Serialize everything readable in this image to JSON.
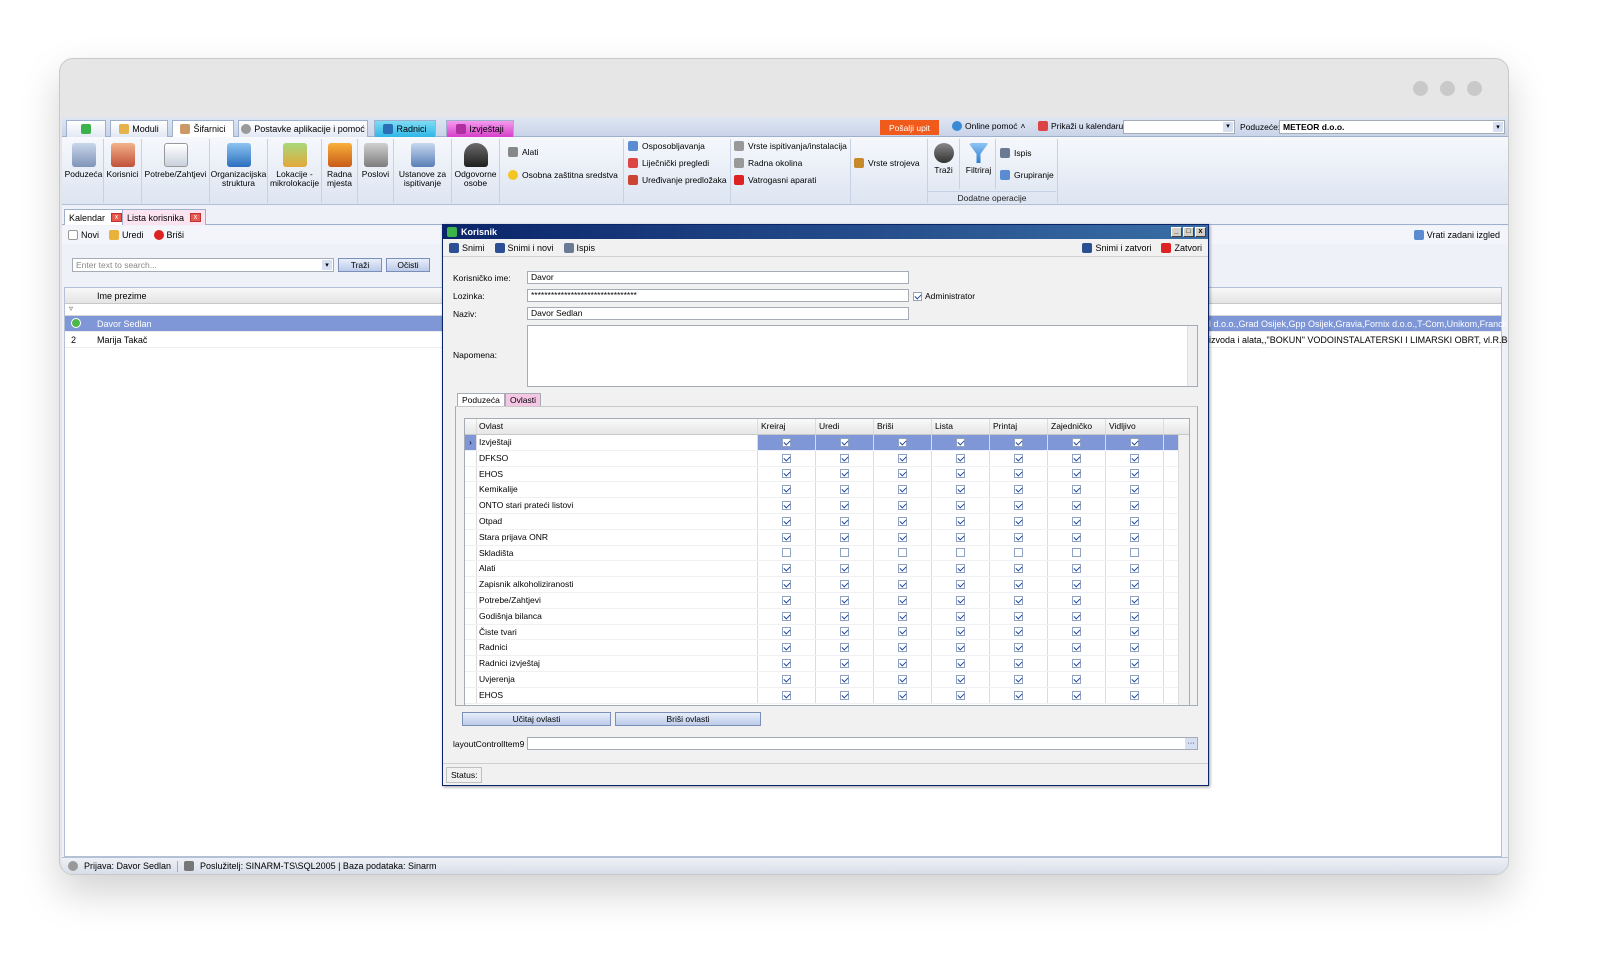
{
  "top_tabs": [
    "Moduli",
    "Šifarnici",
    "Postavke aplikacije i pomoć",
    "Radnici",
    "Izvještaji"
  ],
  "top_right": {
    "send_label": "Pošalji upit",
    "help_label": "Online pomoć",
    "calendar_label": "Prikaži u kalendaru",
    "company_label": "Poduzeće:",
    "company_value": "METEOR d.o.o."
  },
  "ribbon": {
    "buttons": [
      "Poduzeća",
      "Korisnici",
      "Potrebe/Zahtjevi",
      "Organizacijska struktura",
      "Lokacije - mikrolokacije",
      "Radna mjesta",
      "Poslovi",
      "Ustanove za ispitivanje",
      "Odgovorne osobe"
    ],
    "small": [
      "Alati",
      "Osobna zaštitna sredstva",
      "Osposobljavanja",
      "Liječnički pregledi",
      "Uređivanje predložaka",
      "Vrste ispitivanja/instalacija",
      "Radna okolina",
      "Vatrogasni aparati",
      "Vrste strojeva"
    ],
    "ops": {
      "search": "Traži",
      "filter": "Filtriraj",
      "print": "Ispis",
      "group": "Grupiranje",
      "group_title": "Dodatne operacije"
    }
  },
  "doc_tabs": [
    "Kalendar",
    "Lista korisnika"
  ],
  "toolbar": {
    "new": "Novi",
    "edit": "Uredi",
    "delete": "Briši",
    "reset": "Vrati zadani izgled"
  },
  "search": {
    "placeholder": "Enter text to search...",
    "find": "Traži",
    "clear": "Očisti"
  },
  "list": {
    "column": "Ime prezime",
    "rows": [
      {
        "num": "",
        "name": "Davor Sedlan",
        "extra": "l d.o.o.,Grad Osijek,Gpp Osijek,Gravia,Fornix d.o.o.,T-Com,Unikom,Franck ..."
      },
      {
        "num": "2",
        "name": "Marija Takač",
        "extra": "izvoda i alata,,\"BOKUN\" VODOINSTALATERSKI I LIMARSKI OBRT, vl.R.Bo,\"CA..."
      }
    ]
  },
  "status": {
    "login": "Prijava: Davor Sedlan",
    "server": "Poslužitelj: SINARM-TS\\SQL2005 | Baza podataka: Sinarm"
  },
  "dialog": {
    "title": "Korisnik",
    "save": "Snimi",
    "save_new": "Snimi i novi",
    "print": "Ispis",
    "save_close": "Snimi i zatvori",
    "close": "Zatvori",
    "username_label": "Korisničko ime:",
    "username": "Davor",
    "password_label": "Lozinka:",
    "password": "********************************",
    "admin_label": "Administrator",
    "name_label": "Naziv:",
    "name": "Davor Sedlan",
    "note_label": "Napomena:",
    "tabs": [
      "Poduzeća",
      "Ovlasti"
    ],
    "perm_columns": [
      "Ovlast",
      "Kreiraj",
      "Uredi",
      "Briši",
      "Lista",
      "Printaj",
      "Zajedničko",
      "Vidljivo"
    ],
    "perms": [
      "Izvještaji",
      "DFKSO",
      "EHOS",
      "Kemikalije",
      "ONTO stari prateći listovi",
      "Otpad",
      "Stara prijava ONR",
      "Skladišta",
      "Alati",
      "Zapisnik alkoholiziranosti",
      "Potrebe/Zahtjevi",
      "Godišnja bilanca",
      "Čiste tvari",
      "Radnici",
      "Radnici izvještaj",
      "Uvjerenja",
      "EHOS"
    ],
    "unchecked_row": "Skladišta",
    "load_btn": "Učitaj ovlasti",
    "delete_btn": "Briši ovlasti",
    "layout_label": "layoutControlItem9",
    "status_label": "Status:"
  }
}
